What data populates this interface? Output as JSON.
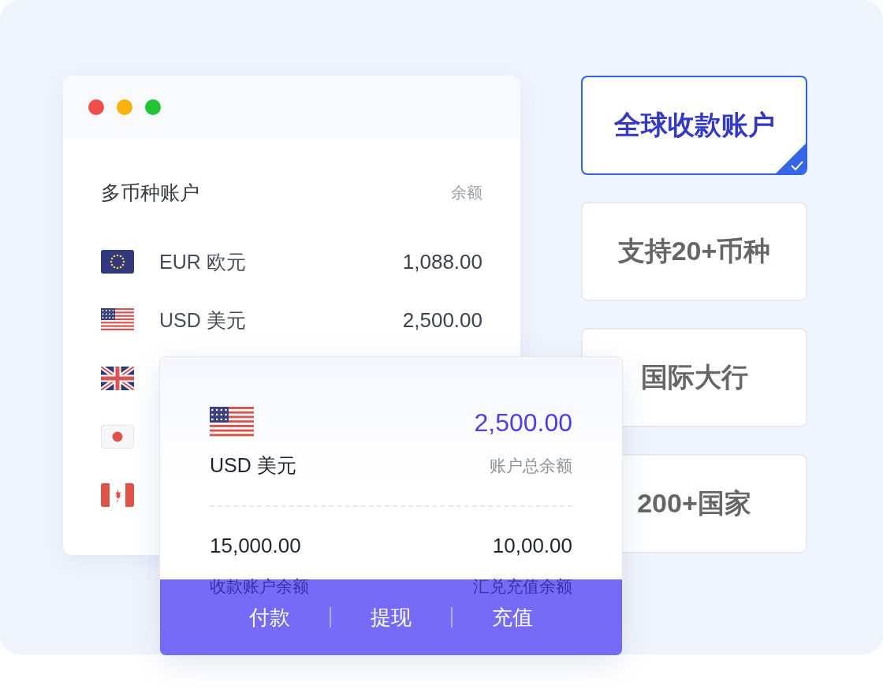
{
  "accounts_window": {
    "title": "多币种账户",
    "balance_header": "余额",
    "accounts": [
      {
        "kind": "full",
        "label": "EUR 欧元",
        "amount": "1,088.00"
      },
      {
        "kind": "full",
        "label": "USD 美元",
        "amount": "2,500.00"
      },
      {
        "kind": "covered"
      },
      {
        "kind": "covered"
      },
      {
        "kind": "covered"
      }
    ]
  },
  "account_card": {
    "currency": "USD 美元",
    "total": "2,500.00",
    "total_label": "账户总余额",
    "receive_amount": "15,000.00",
    "receive_label": "收款账户余额",
    "exchange_amount": "10,00.00",
    "exchange_label": "汇兑充值余额",
    "actions": [
      "付款",
      "提现",
      "充值"
    ]
  },
  "features": [
    {
      "label": "全球收款账户",
      "selected": true
    },
    {
      "label": "支持20+币种",
      "selected": false
    },
    {
      "label": "国际大行",
      "selected": false
    },
    {
      "label": "200+国家",
      "selected": false
    }
  ]
}
